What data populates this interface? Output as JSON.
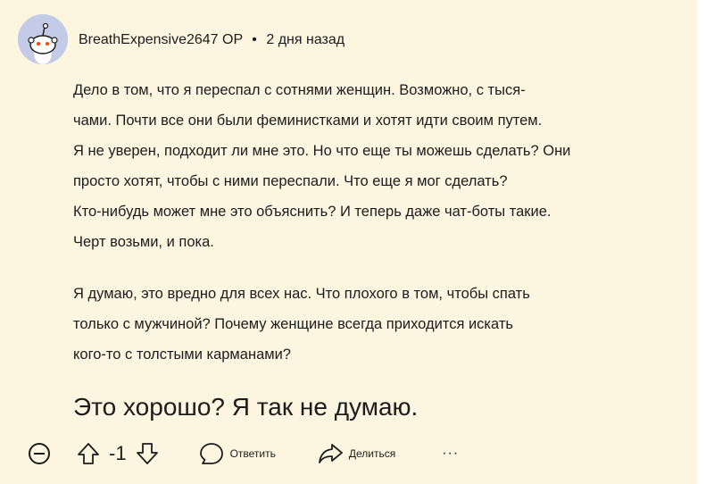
{
  "comment": {
    "author": "BreathExpensive2647",
    "op_badge": "OP",
    "separator": "•",
    "time": "2 дня назад",
    "paragraph1_lines": [
      "Дело в том, что я переспал с сотнями женщин. Возможно, с тыся-",
      "чами. Почти все они были феминистками и хотят идти своим путем.",
      "Я не уверен, подходит ли мне это. Но что еще ты можешь сделать? Они",
      "просто хотят, чтобы с ними переспали. Что еще я мог сделать?",
      "Кто-нибудь может мне это объяснить? И теперь даже чат-боты такие.",
      "Черт возьми, и пока."
    ],
    "paragraph2_lines": [
      "Я думаю, это вредно для всех нас. Что плохого в том, чтобы спать",
      "только с мужчиной? Почему женщине всегда приходится искать",
      "кого-то с толстыми карманами?"
    ],
    "big_text": "Это хорошо? Я так не думаю."
  },
  "actions": {
    "score": "-1",
    "reply_label": "Ответить",
    "share_label": "Делиться",
    "more_label": "···"
  },
  "colors": {
    "background": "#fcf5df",
    "avatar_bg": "#c3cbe6"
  },
  "icons": [
    "collapse-icon",
    "upvote-icon",
    "downvote-icon",
    "comment-icon",
    "share-icon",
    "more-icon",
    "snoo-avatar-icon"
  ]
}
